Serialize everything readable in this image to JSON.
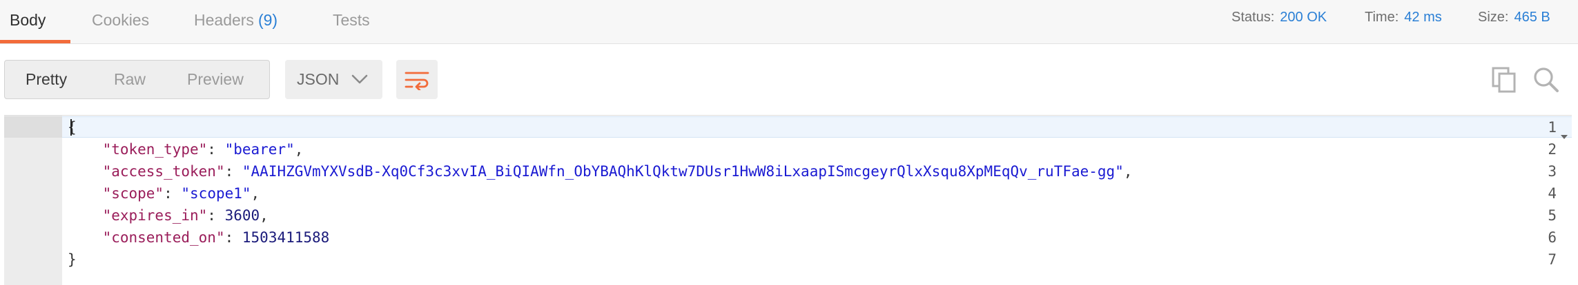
{
  "tabs": [
    {
      "label": "Body"
    },
    {
      "label": "Cookies"
    },
    {
      "label": "Headers",
      "count": "(9)"
    },
    {
      "label": "Tests"
    }
  ],
  "status": {
    "label": "Status:",
    "value": "200 OK"
  },
  "time": {
    "label": "Time:",
    "value": "42 ms"
  },
  "size": {
    "label": "Size:",
    "value": "465 B"
  },
  "view_modes": [
    {
      "label": "Pretty"
    },
    {
      "label": "Raw"
    },
    {
      "label": "Preview"
    }
  ],
  "format_select": {
    "value": "JSON"
  },
  "icons": {
    "wrap": "wrap-lines-icon",
    "copy": "copy-icon",
    "search": "search-icon"
  },
  "colors": {
    "accent": "#f26b3a",
    "link": "#2a7fd5",
    "json_key": "#9a1d5a",
    "json_string": "#1a1ad2",
    "json_number": "#1a1a7a"
  },
  "editor": {
    "line_numbers": [
      "1",
      "2",
      "3",
      "4",
      "5",
      "6",
      "7"
    ],
    "lines": [
      {
        "open": "{"
      },
      {
        "indent": "    ",
        "key": "\"token_type\"",
        "sep": ": ",
        "value": "\"bearer\"",
        "end": ","
      },
      {
        "indent": "    ",
        "key": "\"access_token\"",
        "sep": ": ",
        "value": "\"AAIHZGVmYXVsdB-Xq0Cf3c3xvIA_BiQIAWfn_ObYBAQhKlQktw7DUsr1HwW8iLxaapISmcgeyrQlxXsqu8XpMEqQv_ruTFae-gg\"",
        "end": ","
      },
      {
        "indent": "    ",
        "key": "\"scope\"",
        "sep": ": ",
        "value": "\"scope1\"",
        "end": ","
      },
      {
        "indent": "    ",
        "key": "\"expires_in\"",
        "sep": ": ",
        "value": "3600",
        "end": ","
      },
      {
        "indent": "    ",
        "key": "\"consented_on\"",
        "sep": ": ",
        "value": "1503411588",
        "end": ""
      },
      {
        "close": "}"
      }
    ]
  }
}
